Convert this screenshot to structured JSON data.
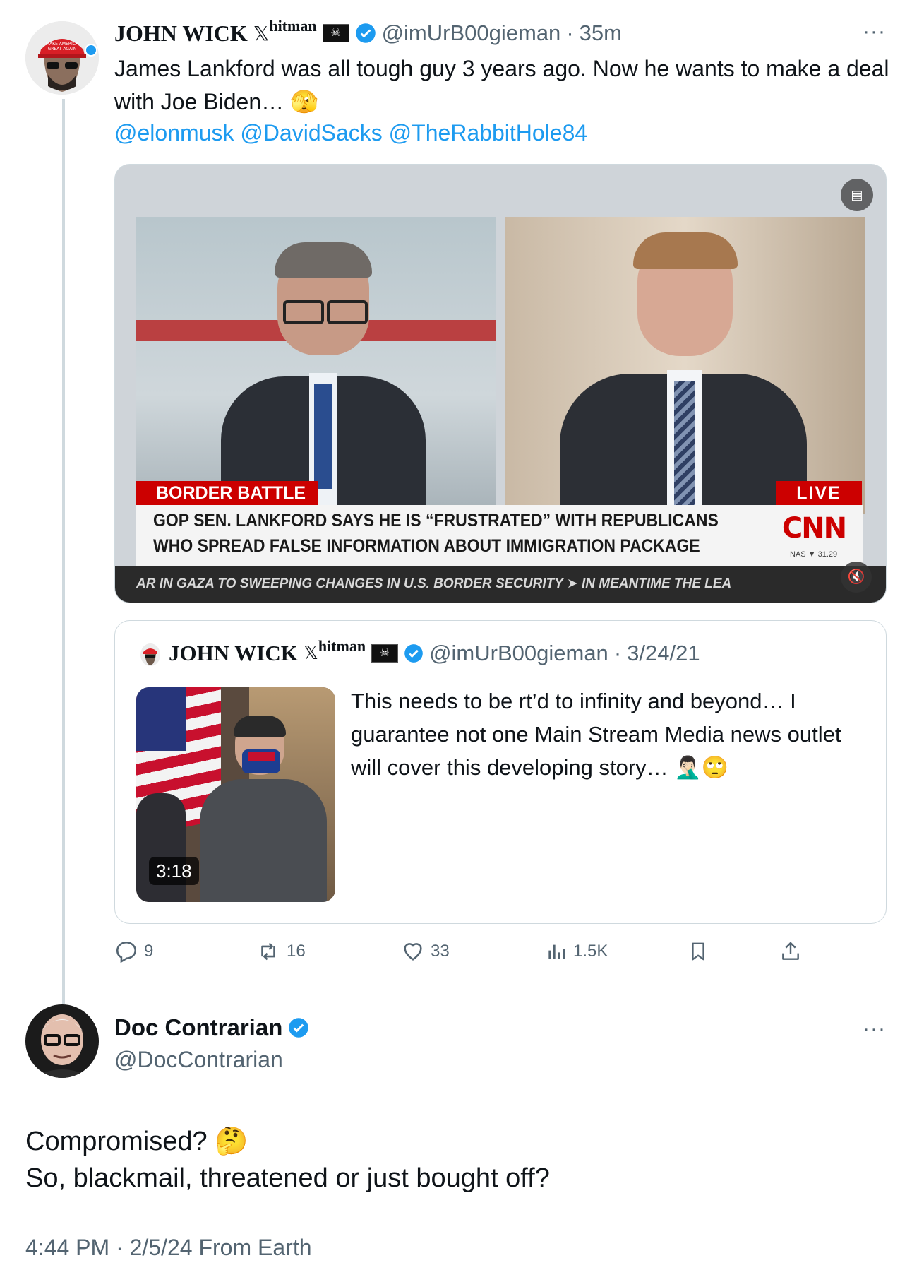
{
  "tweet": {
    "author_name": "JOHN WICK",
    "x_logo": "𝕏",
    "author_suffix": "hitman",
    "flag_icon": "pirate-flag",
    "handle": "@imUrB00gieman",
    "time": "35m",
    "text": "James Lankford was all tough guy 3 years ago.  Now he wants to make a deal with Joe Biden… 🫣",
    "mentions": "@elonmusk @DavidSacks @TheRabbitHole84",
    "video": {
      "lower_third_label": "BORDER BATTLE",
      "live_label": "LIVE",
      "headline_line1": "GOP SEN. LANKFORD SAYS HE IS “FRUSTRATED” WITH REPUBLICANS",
      "headline_line2": "WHO SPREAD FALSE INFORMATION ABOUT IMMIGRATION PACKAGE",
      "network_logo": "CNN",
      "ticker_market": "NAS ▼ 31.29",
      "ticker": "AR IN GAZA TO SWEEPING CHANGES IN U.S. BORDER SECURITY  ➤  IN MEANTIME  THE LEA"
    },
    "quoted": {
      "author_name": "JOHN WICK",
      "x_logo": "𝕏",
      "author_suffix": "hitman",
      "handle": "@imUrB00gieman",
      "date": "3/24/21",
      "text": "This needs to be rt’d to infinity and beyond…  I guarantee not one Main Stream Media news outlet will cover this developing story…  🤦🏻‍♂️🙄",
      "video_duration": "3:18"
    },
    "stats": {
      "replies": "9",
      "retweets": "16",
      "likes": "33",
      "views": "1.5K"
    }
  },
  "reply": {
    "author_name": "Doc Contrarian",
    "handle": "@DocContrarian",
    "text_line1": "Compromised? 🤔",
    "text_line2": "So, blackmail, threatened or just bought off?",
    "timestamp": "4:44 PM · 2/5/24 From Earth"
  },
  "colors": {
    "accent": "#1d9bf0",
    "secondary_text": "#536471",
    "border": "#cfd9de",
    "cnn_red": "#cc0000"
  }
}
